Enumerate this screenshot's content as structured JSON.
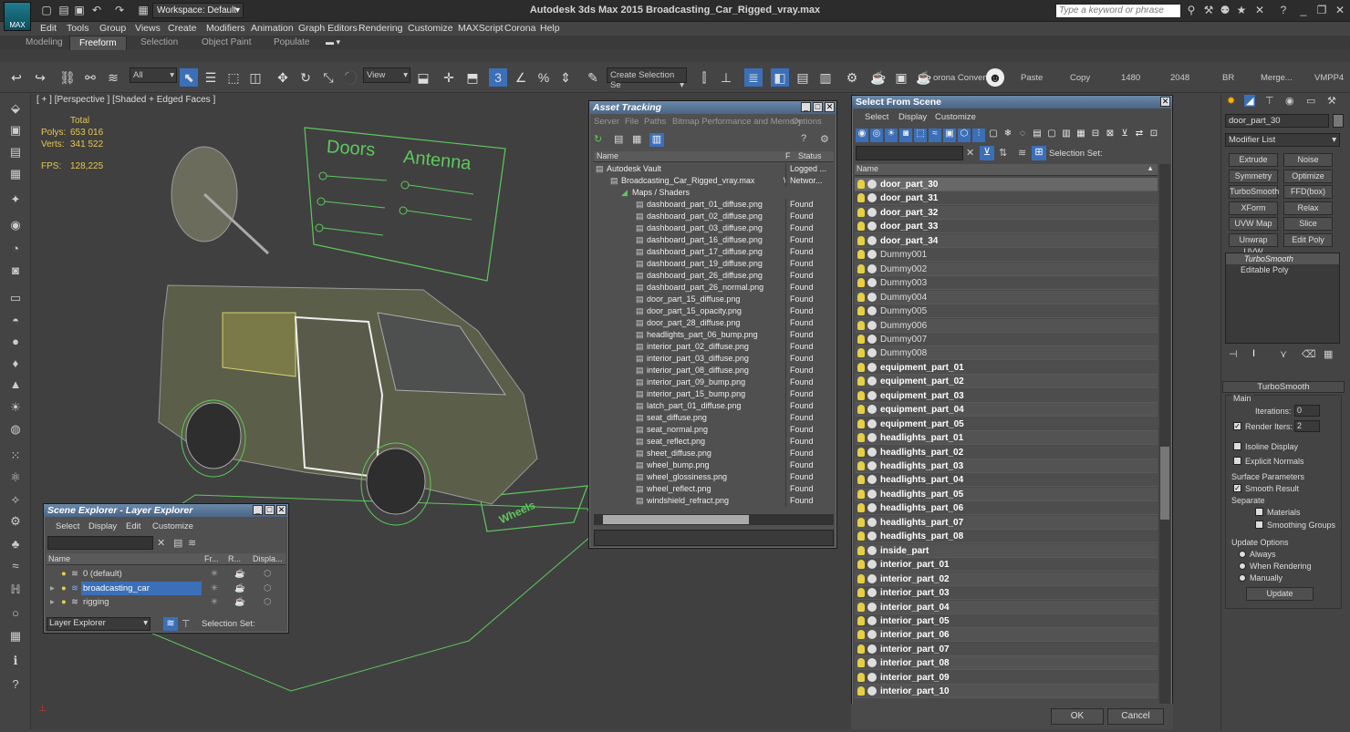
{
  "window": {
    "app_title": "Autodesk 3ds Max  2015    Broadcasting_Car_Rigged_vray.max",
    "workspace": "Workspace: Default",
    "search_placeholder": "Type a keyword or phrase",
    "logo": "MAX"
  },
  "menu": [
    "Edit",
    "Tools",
    "Group",
    "Views",
    "Create",
    "Modifiers",
    "Animation",
    "Graph Editors",
    "Rendering",
    "Customize",
    "MAXScript",
    "Corona",
    "Help"
  ],
  "ribbon_tabs": [
    "Modeling",
    "Freeform",
    "Selection",
    "Object Paint",
    "Populate"
  ],
  "toolbar": {
    "filter": "All",
    "view": "View",
    "selection_set": "Create Selection Se",
    "corona": "orona Convert",
    "paste": "Paste",
    "copy": "Copy",
    "w": "1480",
    "h": "2048",
    "br": "BR",
    "merge": "Merge...",
    "vmpp": "VMPP4"
  },
  "viewport": {
    "label": "[ + ] [Perspective ] [Shaded + Edged Faces ]",
    "total": "Total",
    "polys_label": "Polys:",
    "polys": "653 016",
    "verts_label": "Verts:",
    "verts": "341 522",
    "fps_label": "FPS:",
    "fps": "128,225",
    "board_left": "Doors",
    "board_right": "Antenna",
    "floor_label": "Wheels"
  },
  "asset": {
    "title": "Asset Tracking",
    "menu": [
      "Server",
      "File",
      "Paths",
      "Bitmap Performance and Memory",
      "Options"
    ],
    "col_name": "Name",
    "col_f": "F",
    "col_status": "Status",
    "rows": [
      {
        "n": "Autodesk Vault",
        "f": "",
        "s": "Logged ..."
      },
      {
        "n": "Broadcasting_Car_Rigged_vray.max",
        "f": "\\",
        "s": "Networ..."
      },
      {
        "n": "Maps / Shaders",
        "f": "",
        "s": ""
      },
      {
        "n": "dashboard_part_01_diffuse.png",
        "f": "",
        "s": "Found"
      },
      {
        "n": "dashboard_part_02_diffuse.png",
        "f": "",
        "s": "Found"
      },
      {
        "n": "dashboard_part_03_diffuse.png",
        "f": "",
        "s": "Found"
      },
      {
        "n": "dashboard_part_16_diffuse.png",
        "f": "",
        "s": "Found"
      },
      {
        "n": "dashboard_part_17_diffuse.png",
        "f": "",
        "s": "Found"
      },
      {
        "n": "dashboard_part_19_diffuse.png",
        "f": "",
        "s": "Found"
      },
      {
        "n": "dashboard_part_26_diffuse.png",
        "f": "",
        "s": "Found"
      },
      {
        "n": "dashboard_part_26_normal.png",
        "f": "",
        "s": "Found"
      },
      {
        "n": "door_part_15_diffuse.png",
        "f": "",
        "s": "Found"
      },
      {
        "n": "door_part_15_opacity.png",
        "f": "",
        "s": "Found"
      },
      {
        "n": "door_part_28_diffuse.png",
        "f": "",
        "s": "Found"
      },
      {
        "n": "headlights_part_06_bump.png",
        "f": "",
        "s": "Found"
      },
      {
        "n": "interior_part_02_diffuse.png",
        "f": "",
        "s": "Found"
      },
      {
        "n": "interior_part_03_diffuse.png",
        "f": "",
        "s": "Found"
      },
      {
        "n": "interior_part_08_diffuse.png",
        "f": "",
        "s": "Found"
      },
      {
        "n": "interior_part_09_bump.png",
        "f": "",
        "s": "Found"
      },
      {
        "n": "interior_part_15_bump.png",
        "f": "",
        "s": "Found"
      },
      {
        "n": "latch_part_01_diffuse.png",
        "f": "",
        "s": "Found"
      },
      {
        "n": "seat_diffuse.png",
        "f": "",
        "s": "Found"
      },
      {
        "n": "seat_normal.png",
        "f": "",
        "s": "Found"
      },
      {
        "n": "seat_reflect.png",
        "f": "",
        "s": "Found"
      },
      {
        "n": "sheet_diffuse.png",
        "f": "",
        "s": "Found"
      },
      {
        "n": "wheel_bump.png",
        "f": "",
        "s": "Found"
      },
      {
        "n": "wheel_glossiness.png",
        "f": "",
        "s": "Found"
      },
      {
        "n": "wheel_reflect.png",
        "f": "",
        "s": "Found"
      },
      {
        "n": "windshield_refract.png",
        "f": "",
        "s": "Found"
      }
    ]
  },
  "sfs": {
    "title": "Select From Scene",
    "menu": [
      "Select",
      "Display",
      "Customize"
    ],
    "selection_set": "Selection Set:",
    "col_name": "Name",
    "ok": "OK",
    "cancel": "Cancel",
    "rows": [
      {
        "n": "door_part_30",
        "b": true,
        "sel": true
      },
      {
        "n": "door_part_31",
        "b": true
      },
      {
        "n": "door_part_32",
        "b": true
      },
      {
        "n": "door_part_33",
        "b": true
      },
      {
        "n": "door_part_34",
        "b": true
      },
      {
        "n": "Dummy001"
      },
      {
        "n": "Dummy002"
      },
      {
        "n": "Dummy003"
      },
      {
        "n": "Dummy004"
      },
      {
        "n": "Dummy005"
      },
      {
        "n": "Dummy006"
      },
      {
        "n": "Dummy007"
      },
      {
        "n": "Dummy008"
      },
      {
        "n": "equipment_part_01",
        "b": true
      },
      {
        "n": "equipment_part_02",
        "b": true
      },
      {
        "n": "equipment_part_03",
        "b": true
      },
      {
        "n": "equipment_part_04",
        "b": true
      },
      {
        "n": "equipment_part_05",
        "b": true
      },
      {
        "n": "headlights_part_01",
        "b": true
      },
      {
        "n": "headlights_part_02",
        "b": true
      },
      {
        "n": "headlights_part_03",
        "b": true
      },
      {
        "n": "headlights_part_04",
        "b": true
      },
      {
        "n": "headlights_part_05",
        "b": true
      },
      {
        "n": "headlights_part_06",
        "b": true
      },
      {
        "n": "headlights_part_07",
        "b": true
      },
      {
        "n": "headlights_part_08",
        "b": true
      },
      {
        "n": "inside_part",
        "b": true
      },
      {
        "n": "interior_part_01",
        "b": true
      },
      {
        "n": "interior_part_02",
        "b": true
      },
      {
        "n": "interior_part_03",
        "b": true
      },
      {
        "n": "interior_part_04",
        "b": true
      },
      {
        "n": "interior_part_05",
        "b": true
      },
      {
        "n": "interior_part_06",
        "b": true
      },
      {
        "n": "interior_part_07",
        "b": true
      },
      {
        "n": "interior_part_08",
        "b": true
      },
      {
        "n": "interior_part_09",
        "b": true
      },
      {
        "n": "interior_part_10",
        "b": true
      }
    ]
  },
  "cmd": {
    "object_name": "door_part_30",
    "modifier_list": "Modifier List",
    "buttons": [
      "Extrude",
      "Noise",
      "Symmetry",
      "Optimize",
      "TurboSmooth",
      "FFD(box)",
      "XForm",
      "Relax",
      "UVW Map",
      "Slice",
      "Unwrap UVW",
      "Edit Poly"
    ],
    "stack": [
      "TurboSmooth",
      "Editable Poly"
    ],
    "rollout": "TurboSmooth",
    "main": "Main",
    "iterations_label": "Iterations:",
    "iterations": "0",
    "render_iters_label": "Render Iters:",
    "render_iters": "2",
    "isoline": "Isoline Display",
    "explicit": "Explicit Normals",
    "surface": "Surface Parameters",
    "smooth_result": "Smooth Result",
    "separate": "Separate",
    "materials": "Materials",
    "smoothing_groups": "Smoothing Groups",
    "update_options": "Update Options",
    "always": "Always",
    "when_rendering": "When Rendering",
    "manually": "Manually",
    "update": "Update"
  },
  "layer": {
    "title": "Scene Explorer - Layer Explorer",
    "menu": [
      "Select",
      "Display",
      "Edit",
      "Customize"
    ],
    "cols": [
      "Name",
      "Fr...",
      "R...",
      "Displa..."
    ],
    "rows": [
      "0 (default)",
      "broadcasting_car",
      "rigging"
    ],
    "explorer": "Layer Explorer",
    "selection_set": "Selection Set:"
  },
  "colors": {
    "accent": "#3b6fb8",
    "wire": "#5ec85e",
    "stat": "#e6c650"
  }
}
